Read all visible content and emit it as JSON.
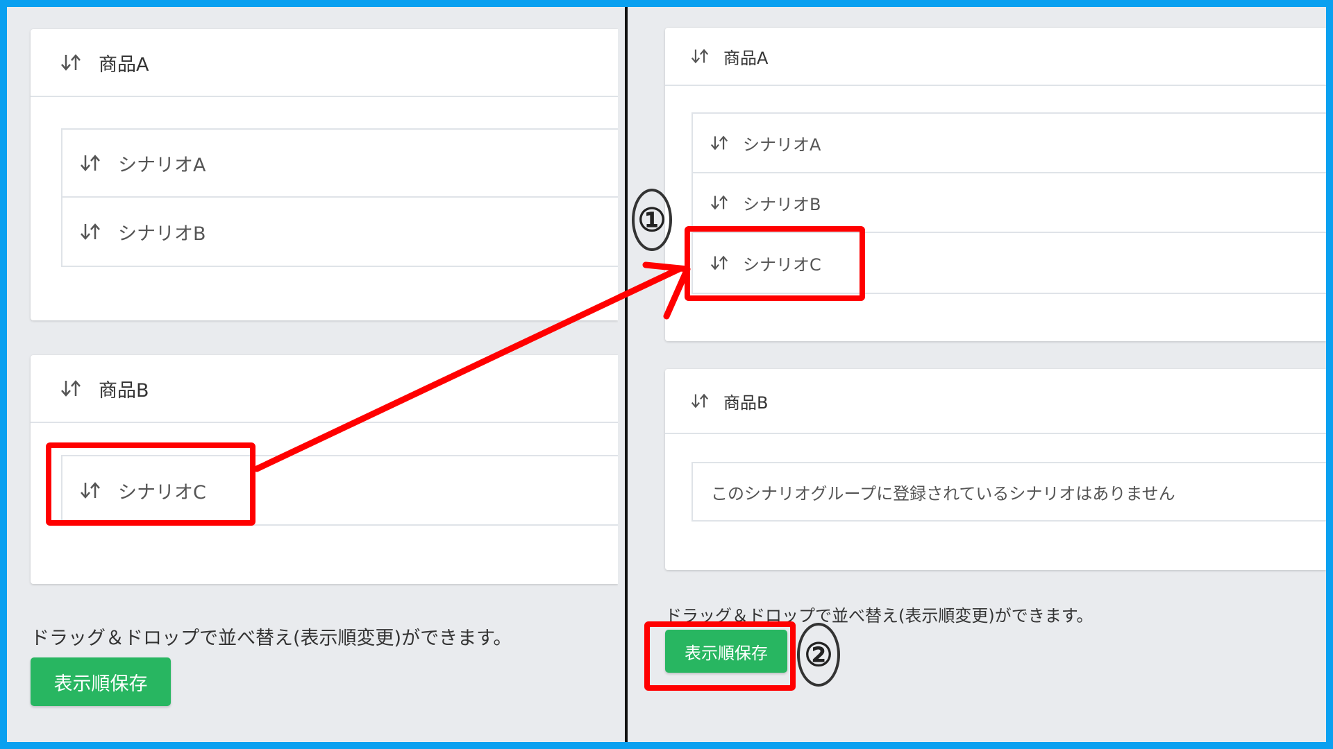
{
  "left_panel": {
    "groups": [
      {
        "title": "商品A",
        "items": [
          "シナリオA",
          "シナリオB"
        ]
      },
      {
        "title": "商品B",
        "items": [
          "シナリオC"
        ]
      }
    ],
    "note": "ドラッグ＆ドロップで並べ替え(表示順変更)ができます。",
    "save_button": "表示順保存"
  },
  "right_panel": {
    "groups": [
      {
        "title": "商品A",
        "items": [
          "シナリオA",
          "シナリオB",
          "シナリオC"
        ]
      },
      {
        "title": "商品B",
        "empty_message": "このシナリオグループに登録されているシナリオはありません"
      }
    ],
    "note": "ドラッグ＆ドロップで並べ替え(表示順変更)ができます。",
    "save_button": "表示順保存"
  },
  "annotations": {
    "step1": "①",
    "step2": "②",
    "highlight_color": "#ff0000",
    "frame_color": "#0aa0f0"
  },
  "icons": {
    "sort": "sort-arrows-icon"
  }
}
